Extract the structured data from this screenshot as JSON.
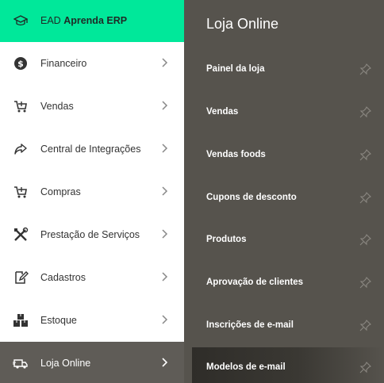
{
  "header": {
    "ead_prefix": "EAD",
    "ead_name": "Aprenda ERP"
  },
  "menu": [
    {
      "label": "Financeiro",
      "icon": "dollar-icon"
    },
    {
      "label": "Vendas",
      "icon": "cart-icon"
    },
    {
      "label": "Central de Integrações",
      "icon": "share-icon"
    },
    {
      "label": "Compras",
      "icon": "cart-icon"
    },
    {
      "label": "Prestação de Serviços",
      "icon": "tools-icon"
    },
    {
      "label": "Cadastros",
      "icon": "edit-icon"
    },
    {
      "label": "Estoque",
      "icon": "boxes-icon"
    },
    {
      "label": "Loja Online",
      "icon": "truck-icon"
    }
  ],
  "submenu": {
    "title": "Loja Online",
    "items": [
      {
        "label": "Painel da loja"
      },
      {
        "label": "Vendas"
      },
      {
        "label": "Vendas foods"
      },
      {
        "label": "Cupons de desconto"
      },
      {
        "label": "Produtos"
      },
      {
        "label": "Aprovação de clientes"
      },
      {
        "label": "Inscrições de e-mail"
      },
      {
        "label": "Modelos de e-mail"
      }
    ]
  },
  "colors": {
    "accent": "#00e89a",
    "submenu_bg": "#56534d",
    "active_bg": "#5f5c57"
  }
}
